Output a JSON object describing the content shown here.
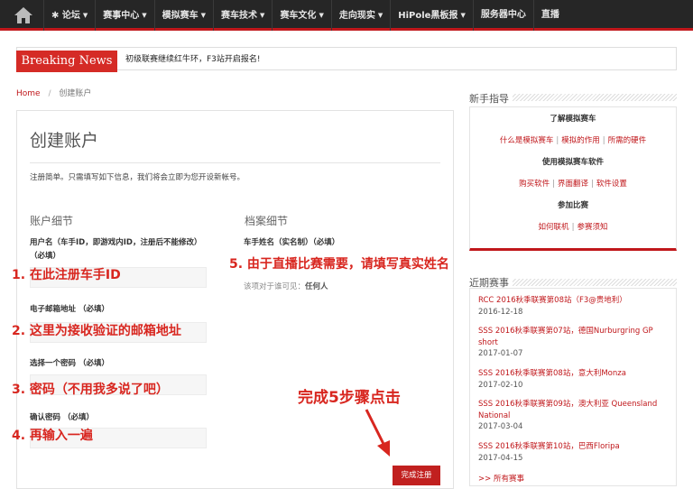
{
  "nav": {
    "items": [
      {
        "label": "论坛",
        "star": true,
        "caret": true
      },
      {
        "label": "赛事中心",
        "caret": true
      },
      {
        "label": "模拟赛车",
        "caret": true
      },
      {
        "label": "赛车技术",
        "caret": true
      },
      {
        "label": "赛车文化",
        "caret": true
      },
      {
        "label": "走向现实",
        "caret": true
      },
      {
        "label": "HiPole黑板报",
        "caret": true
      },
      {
        "label": "服务器中心",
        "caret": false
      },
      {
        "label": "直播",
        "caret": false
      }
    ]
  },
  "breaking": {
    "tag": "Breaking News",
    "text": "初级联赛继续红牛环，F3站开启报名!"
  },
  "breadcrumb": {
    "home": "Home",
    "sep": "/",
    "current": "创建账户"
  },
  "form": {
    "title": "创建账户",
    "intro": "注册简单。只需填写如下信息，我们将会立即为您开设新帐号。",
    "account_section": "账户细节",
    "profile_section": "档案细节",
    "username_label": "用户名（车手ID，即游戏内ID，注册后不能修改）",
    "required": "（必填）",
    "email_label": "电子邮箱地址 （必填）",
    "password_label": "选择一个密码 （必填）",
    "confirm_label": "确认密码 （必填）",
    "realname_label": "车手姓名（实名制）（必填）",
    "visibility_note": "该项对于谁可见：",
    "visibility_value": "任何人",
    "submit": "完成注册"
  },
  "annotations": {
    "a1": "1. 在此注册车手ID",
    "a2": "2. 这里为接收验证的邮箱地址",
    "a3": "3. 密码（不用我多说了吧）",
    "a4": "4. 再输入一遍",
    "a5": "5. 由于直播比赛需要，请填写真实姓名",
    "a6": "完成5步骤点击"
  },
  "sidebar": {
    "guide_title": "新手指导",
    "guide": {
      "h1": "了解模拟赛车",
      "l1": [
        "什么是模拟赛车",
        "模拟的作用",
        "所需的硬件"
      ],
      "h2": "使用模拟赛车软件",
      "l2": [
        "购买软件",
        "界面翻译",
        "软件设置"
      ],
      "h3": "参加比赛",
      "l3": [
        "如何联机",
        "参赛须知"
      ]
    },
    "races_title": "近期赛事",
    "races": [
      {
        "title": "RCC 2016秋季联赛第08站（F3@贵地利）",
        "date": "2016-12-18"
      },
      {
        "title": "SSS 2016秋季联赛第07站，德国Nurburgring GP short",
        "date": "2017-01-07"
      },
      {
        "title": "SSS 2016秋季联赛第08站，意大利Monza",
        "date": "2017-02-10"
      },
      {
        "title": "SSS 2016秋季联赛第09站，澳大利亚 Queensland National",
        "date": "2017-03-04"
      },
      {
        "title": "SSS 2016秋季联赛第10站，巴西Floripa",
        "date": "2017-04-15"
      }
    ],
    "all": ">> 所有赛事"
  },
  "colors": {
    "accent": "#c0171b",
    "annotation": "#d8261f",
    "nav_bg": "#262626"
  }
}
